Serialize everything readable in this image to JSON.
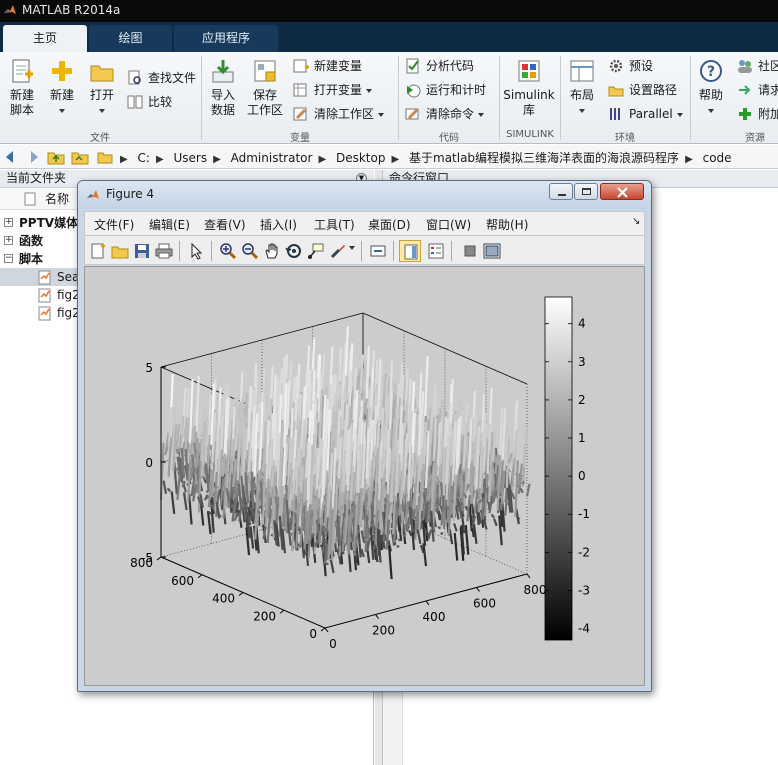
{
  "app": {
    "title": "MATLAB R2014a"
  },
  "tabs": [
    {
      "label": "主页"
    },
    {
      "label": "绘图"
    },
    {
      "label": "应用程序"
    }
  ],
  "ribbon": {
    "new_script": "新建\n脚本",
    "new": "新建",
    "open": "打开",
    "find_files": "查找文件",
    "compare": "比较",
    "import_data": "导入\n数据",
    "save_workspace": "保存\n工作区",
    "new_variable": "新建变量",
    "open_variable": "打开变量",
    "clear_workspace": "清除工作区",
    "analyze_code": "分析代码",
    "run_and_time": "运行和计时",
    "clear_commands": "清除命令",
    "simulink": "Simulink\n库",
    "layout": "布局",
    "preferences": "预设",
    "set_path": "设置路径",
    "parallel": "Parallel",
    "help": "帮助",
    "community": "社区",
    "request": "请求",
    "addons": "附加",
    "groups": {
      "file": "文件",
      "variable": "变量",
      "code": "代码",
      "simulink": "SIMULINK",
      "environment": "环境",
      "resources": "资源"
    }
  },
  "address": {
    "crumbs": [
      "C:",
      "Users",
      "Administrator",
      "Desktop",
      "基于matlab编程模拟三维海洋表面的海浪源码程序",
      "code"
    ]
  },
  "current_folder": {
    "title": "当前文件夹",
    "column": "名称",
    "items": [
      {
        "label": "PPTV媒体",
        "type": "folder"
      },
      {
        "label": "函数",
        "type": "folder"
      },
      {
        "label": "脚本",
        "type": "folder"
      },
      {
        "label": "Sea",
        "type": "file"
      },
      {
        "label": "fig2",
        "type": "file"
      },
      {
        "label": "fig2",
        "type": "file"
      }
    ]
  },
  "command_window": {
    "title": "命令行窗口"
  },
  "figure": {
    "title": "Figure 4",
    "menu": [
      "文件(F)",
      "编辑(E)",
      "查看(V)",
      "插入(I)",
      "工具(T)",
      "桌面(D)",
      "窗口(W)",
      "帮助(H)"
    ],
    "toolbar_icons": [
      "new-figure-icon",
      "open-file-icon",
      "save-icon",
      "print-icon",
      "pointer-icon",
      "zoom-in-icon",
      "zoom-out-icon",
      "pan-icon",
      "rotate-3d-icon",
      "data-cursor-icon",
      "brush-icon",
      "link-icon",
      "colorbar-icon",
      "legend-icon",
      "hide-plot-tools-icon",
      "show-plot-tools-icon"
    ]
  },
  "chart_data": {
    "type": "surface",
    "colormap": "gray",
    "x_ticks": [
      "0",
      "200",
      "400",
      "600",
      "800"
    ],
    "y_ticks": [
      "0",
      "200",
      "400",
      "600",
      "800"
    ],
    "z_ticks": [
      "-5",
      "0",
      "5"
    ],
    "zlim": [
      -5,
      5
    ],
    "colorbar_ticks": [
      "-4",
      "-3",
      "-2",
      "-1",
      "0",
      "1",
      "2",
      "3",
      "4"
    ],
    "colorbar_range": [
      -4.3,
      4.7
    ],
    "xlim": [
      0,
      800
    ],
    "ylim": [
      0,
      800
    ]
  }
}
